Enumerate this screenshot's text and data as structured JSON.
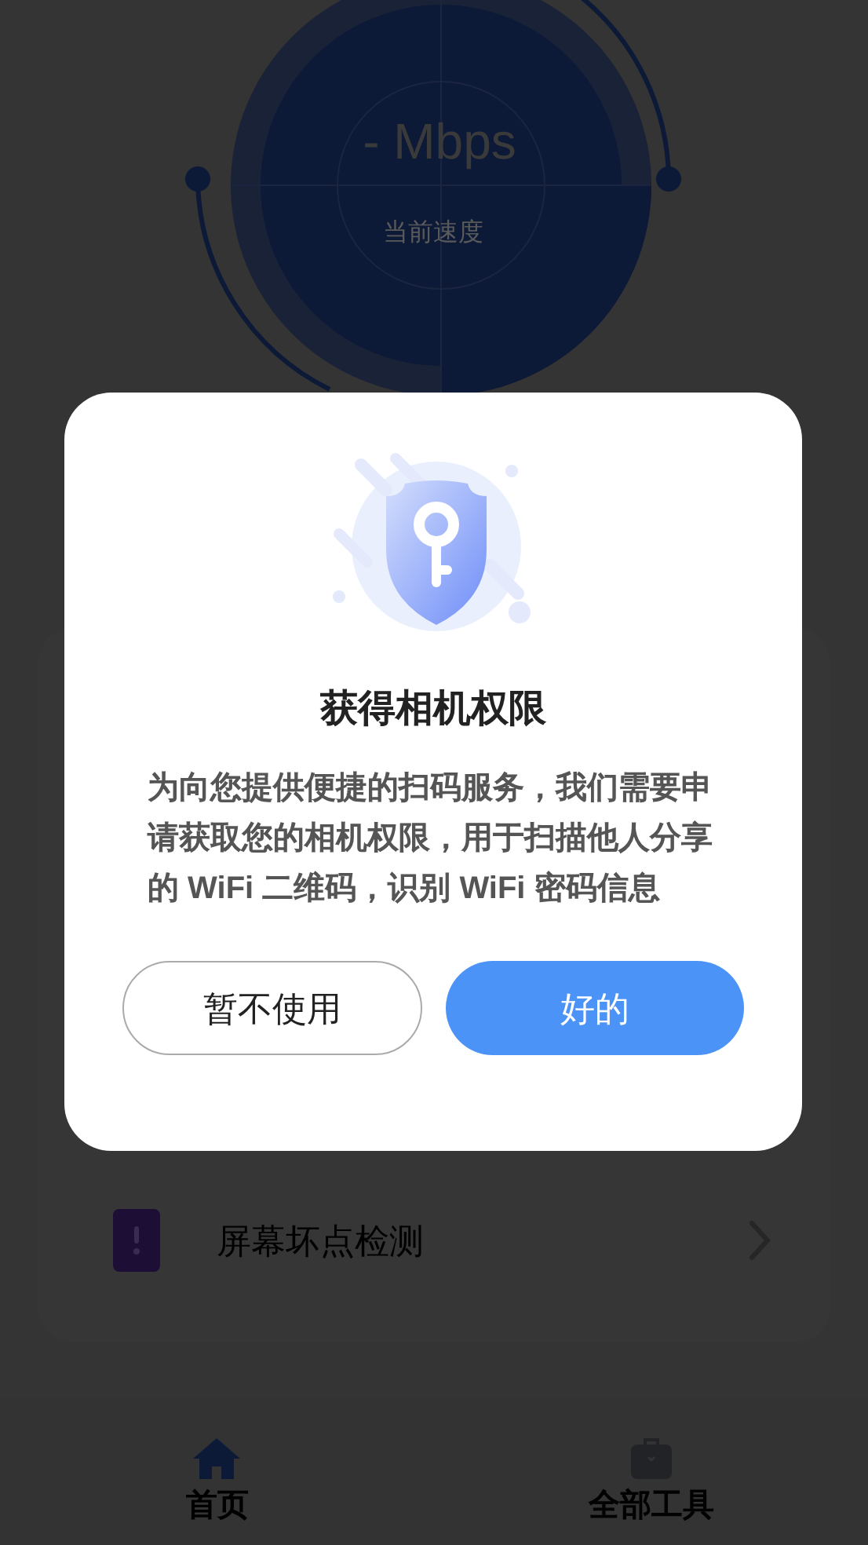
{
  "speed_gauge": {
    "value": "- Mbps",
    "caption": "当前速度"
  },
  "tools": [
    {
      "label": "屏幕坏点检测"
    }
  ],
  "dialog": {
    "title": "获得相机权限",
    "message": "为向您提供便捷的扫码服务，我们需要申请获取您的相机权限，用于扫描他人分享的 WiFi 二维码，识别 WiFi 密码信息",
    "buttons": [
      {
        "label": "暂不使用",
        "kind": "secondary"
      },
      {
        "label": "好的",
        "kind": "primary"
      }
    ]
  },
  "tab_bar": [
    {
      "label": "首页",
      "selected": true
    },
    {
      "label": "全部工具",
      "selected": false
    }
  ]
}
